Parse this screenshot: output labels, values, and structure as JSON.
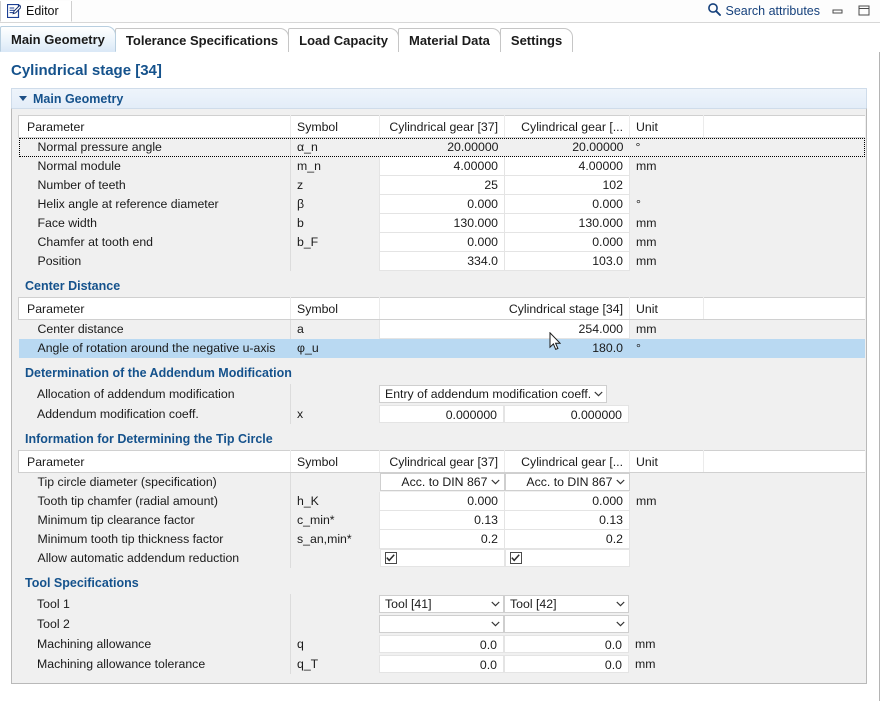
{
  "window": {
    "view_tab_label": "Editor",
    "search_label": "Search attributes",
    "minimize_title": "Minimize",
    "restore_title": "Restore"
  },
  "tabs": [
    {
      "label": "Main Geometry",
      "active": true
    },
    {
      "label": "Tolerance Specifications",
      "active": false
    },
    {
      "label": "Load Capacity",
      "active": false
    },
    {
      "label": "Material Data",
      "active": false
    },
    {
      "label": "Settings",
      "active": false
    }
  ],
  "page": {
    "title": "Cylindrical stage [34]",
    "section_label": "Main Geometry"
  },
  "main_geometry_table": {
    "headers": [
      "Parameter",
      "Symbol",
      "Cylindrical gear [37]",
      "Cylindrical gear [...",
      "Unit",
      ""
    ],
    "rows": [
      {
        "param": "Normal pressure angle",
        "symbol": "α_n",
        "v1": "20.00000",
        "v2": "20.00000",
        "unit": "°",
        "focus": true
      },
      {
        "param": "Normal module",
        "symbol": "m_n",
        "v1": "4.00000",
        "v2": "4.00000",
        "unit": "mm"
      },
      {
        "param": "Number of teeth",
        "symbol": "z",
        "v1": "25",
        "v2": "102",
        "unit": ""
      },
      {
        "param": "Helix angle at reference diameter",
        "symbol": "β",
        "v1": "0.000",
        "v2": "0.000",
        "unit": "°"
      },
      {
        "param": "Face width",
        "symbol": "b",
        "v1": "130.000",
        "v2": "130.000",
        "unit": "mm"
      },
      {
        "param": "Chamfer at tooth end",
        "symbol": "b_F",
        "v1": "0.000",
        "v2": "0.000",
        "unit": "mm"
      },
      {
        "param": "Position",
        "symbol": "",
        "v1": "334.0",
        "v2": "103.0",
        "unit": "mm"
      }
    ]
  },
  "center_distance": {
    "heading": "Center Distance",
    "headers": [
      "Parameter",
      "Symbol",
      "Cylindrical stage [34]",
      "Unit",
      ""
    ],
    "rows": [
      {
        "param": "Center distance",
        "symbol": "a",
        "v1": "254.000",
        "unit": "mm",
        "selected": false
      },
      {
        "param": "Angle of rotation around the negative u-axis",
        "symbol": "φ_u",
        "v1": "180.0",
        "unit": "°",
        "selected": true
      }
    ]
  },
  "addendum": {
    "heading": "Determination of the Addendum Modification",
    "allocation_label": "Allocation of addendum modification",
    "allocation_value": "Entry of addendum modification coeff.",
    "coeff_label": "Addendum modification coeff.",
    "coeff_symbol": "x",
    "coeff_v1": "0.000000",
    "coeff_v2": "0.000000"
  },
  "tip_circle": {
    "heading": "Information for Determining the Tip Circle",
    "headers": [
      "Parameter",
      "Symbol",
      "Cylindrical gear [37]",
      "Cylindrical gear [...",
      "Unit",
      ""
    ],
    "rows": [
      {
        "param": "Tip circle diameter (specification)",
        "symbol": "",
        "type": "combo",
        "v1": "Acc. to DIN 867",
        "v2": "Acc. to DIN 867",
        "unit": ""
      },
      {
        "param": "Tooth tip chamfer (radial amount)",
        "symbol": "h_K",
        "type": "num",
        "v1": "0.000",
        "v2": "0.000",
        "unit": "mm"
      },
      {
        "param": "Minimum tip clearance factor",
        "symbol": "c_min*",
        "type": "num",
        "v1": "0.13",
        "v2": "0.13",
        "unit": ""
      },
      {
        "param": "Minimum tooth tip thickness factor",
        "symbol": "s_an,min*",
        "type": "num",
        "v1": "0.2",
        "v2": "0.2",
        "unit": ""
      },
      {
        "param": "Allow automatic addendum reduction",
        "symbol": "",
        "type": "check",
        "v1": "checked",
        "v2": "checked",
        "unit": ""
      }
    ]
  },
  "tool_spec": {
    "heading": "Tool Specifications",
    "rows": [
      {
        "param": "Tool 1",
        "symbol": "",
        "type": "combo",
        "v1": "Tool [41]",
        "v2": "Tool [42]",
        "unit": ""
      },
      {
        "param": "Tool 2",
        "symbol": "",
        "type": "combo",
        "v1": "",
        "v2": "",
        "unit": ""
      },
      {
        "param": "Machining allowance",
        "symbol": "q",
        "type": "num",
        "v1": "0.0",
        "v2": "0.0",
        "unit": "mm"
      },
      {
        "param": "Machining allowance tolerance",
        "symbol": "q_T",
        "type": "num",
        "v1": "0.0",
        "v2": "0.0",
        "unit": "mm"
      }
    ]
  },
  "colors": {
    "accent": "#15528c",
    "selection": "#b9d9f2",
    "panel_bg": "#f0f0f0"
  }
}
